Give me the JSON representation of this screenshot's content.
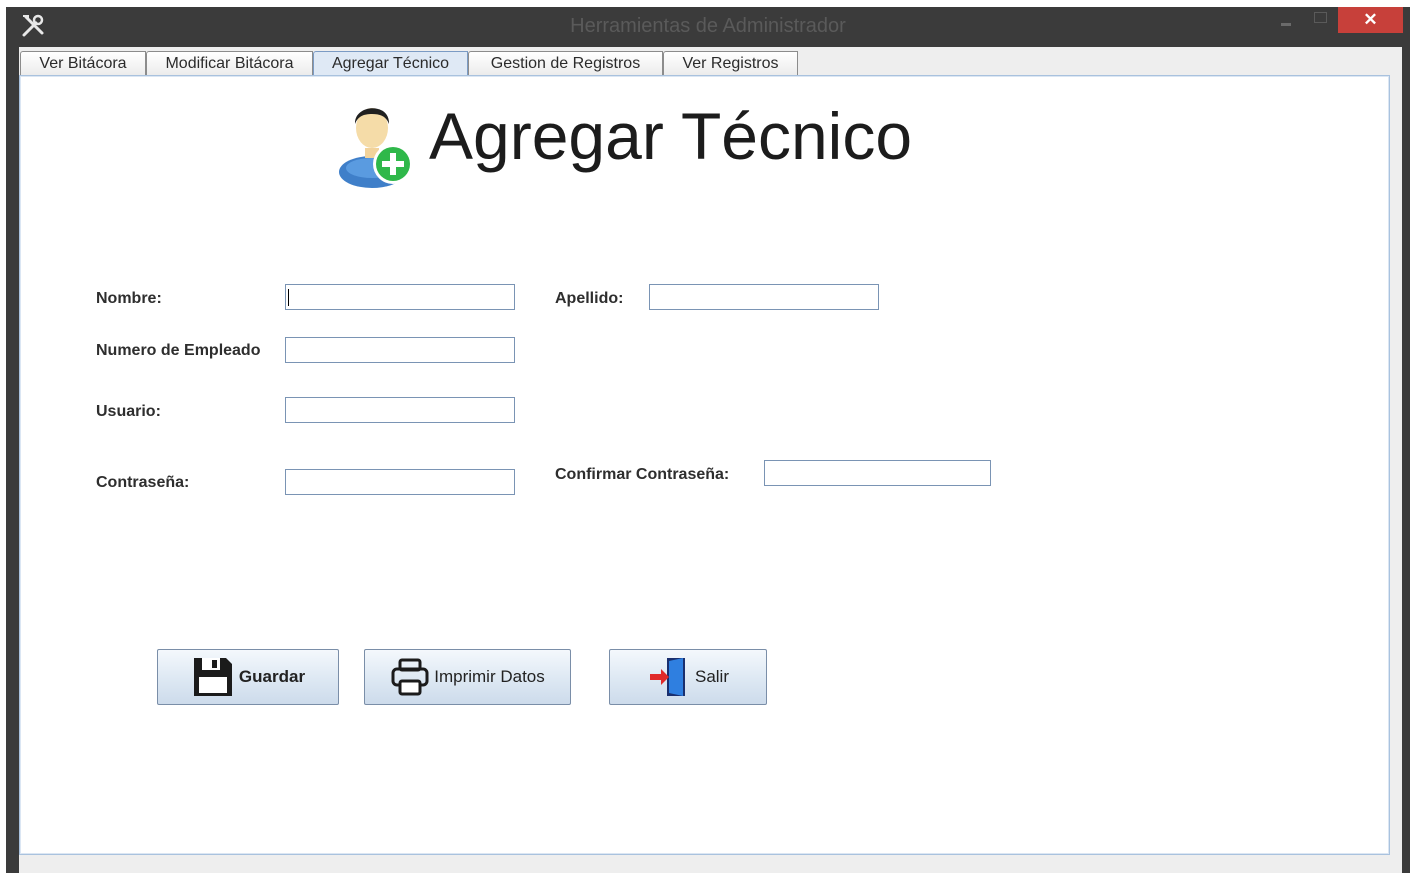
{
  "window": {
    "title": "Herramientas de Administrador",
    "close_glyph": "✕"
  },
  "tabs": [
    {
      "label": "Ver Bitácora",
      "selected": false
    },
    {
      "label": "Modificar Bitácora",
      "selected": false
    },
    {
      "label": "Agregar Técnico",
      "selected": true
    },
    {
      "label": "Gestion de Registros",
      "selected": false
    },
    {
      "label": "Ver Registros",
      "selected": false
    }
  ],
  "header": {
    "title": "Agregar Técnico",
    "icon": "add-user-icon"
  },
  "form": {
    "nombre_label": "Nombre:",
    "nombre_value": "",
    "apellido_label": "Apellido:",
    "apellido_value": "",
    "empleado_label": "Numero de Empleado",
    "empleado_value": "",
    "usuario_label": "Usuario:",
    "usuario_value": "",
    "contrasena_label": "Contraseña:",
    "contrasena_value": "",
    "confirmar_label": "Confirmar Contraseña:",
    "confirmar_value": ""
  },
  "buttons": {
    "guardar": {
      "label": "Guardar",
      "icon": "floppy-disk-icon"
    },
    "imprimir": {
      "label": "Imprimir Datos",
      "icon": "printer-icon"
    },
    "salir": {
      "label": "Salir",
      "icon": "exit-door-icon"
    }
  },
  "colors": {
    "close_button": "#c7403a",
    "selected_tab": "#dfe9f5",
    "add_badge": "#2fb84a"
  }
}
